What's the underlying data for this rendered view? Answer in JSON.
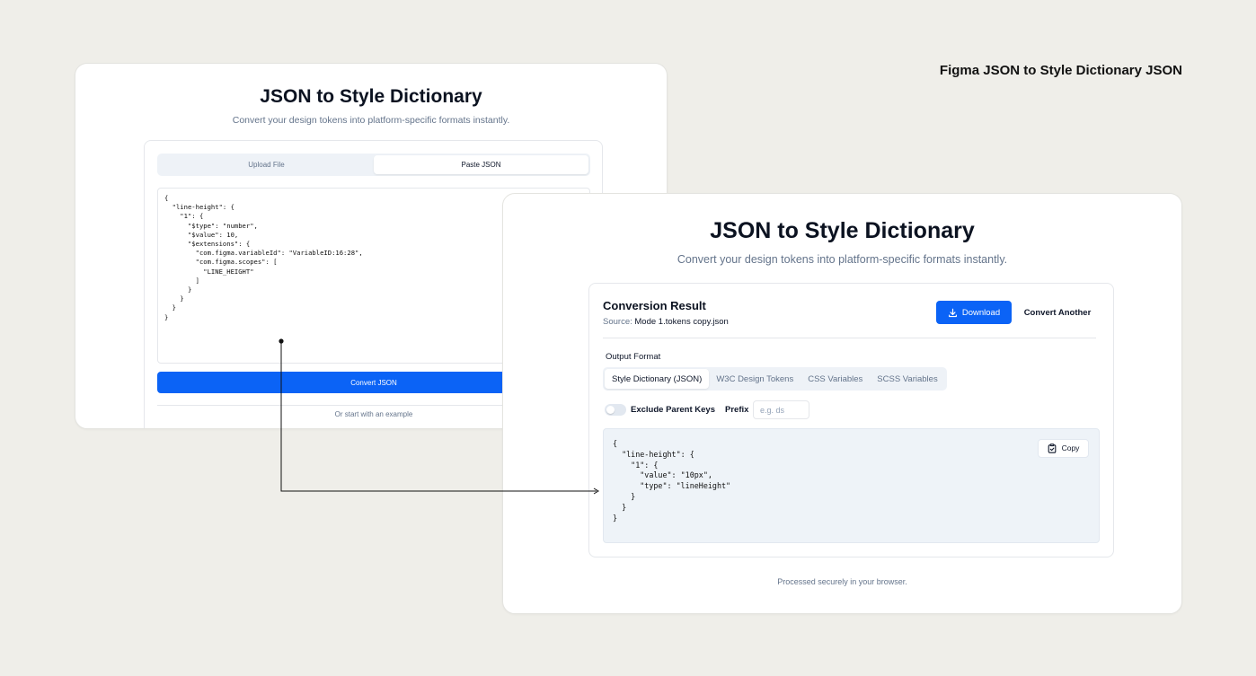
{
  "caption": "Figma JSON to Style Dictionary JSON",
  "colors": {
    "accent": "#0b63f6",
    "background": "#efeee9"
  },
  "back_card": {
    "title": "JSON to Style Dictionary",
    "subtitle": "Convert your design tokens into platform-specific formats instantly.",
    "tabs": [
      {
        "label": "Upload File",
        "active": false
      },
      {
        "label": "Paste JSON",
        "active": true
      }
    ],
    "input_json": "{\n  \"line-height\": {\n    \"1\": {\n      \"$type\": \"number\",\n      \"$value\": 10,\n      \"$extensions\": {\n        \"com.figma.variableId\": \"VariableID:16:28\",\n        \"com.figma.scopes\": [\n          \"LINE_HEIGHT\"\n        ]\n      }\n    }\n  }\n}",
    "convert_label": "Convert JSON",
    "example_label": "Or start with an example"
  },
  "front_card": {
    "title": "JSON to Style Dictionary",
    "subtitle": "Convert your design tokens into platform-specific formats instantly.",
    "result": {
      "title": "Conversion Result",
      "source_label": "Source:",
      "source_file": "Mode 1.tokens copy.json",
      "download_label": "Download",
      "download_icon": "download-icon",
      "convert_another_label": "Convert Another",
      "output_format_label": "Output Format",
      "formats": [
        {
          "label": "Style Dictionary (JSON)",
          "active": true
        },
        {
          "label": "W3C Design Tokens",
          "active": false
        },
        {
          "label": "CSS Variables",
          "active": false
        },
        {
          "label": "SCSS Variables",
          "active": false
        }
      ],
      "exclude_parent_keys_label": "Exclude Parent Keys",
      "exclude_parent_keys_on": false,
      "prefix_label": "Prefix",
      "prefix_value": "",
      "prefix_placeholder": "e.g. ds",
      "output_json": "{\n  \"line-height\": {\n    \"1\": {\n      \"value\": \"10px\",\n      \"type\": \"lineHeight\"\n    }\n  }\n}",
      "copy_label": "Copy",
      "copy_icon": "clipboard-icon"
    },
    "secure_note": "Processed securely in your browser."
  }
}
